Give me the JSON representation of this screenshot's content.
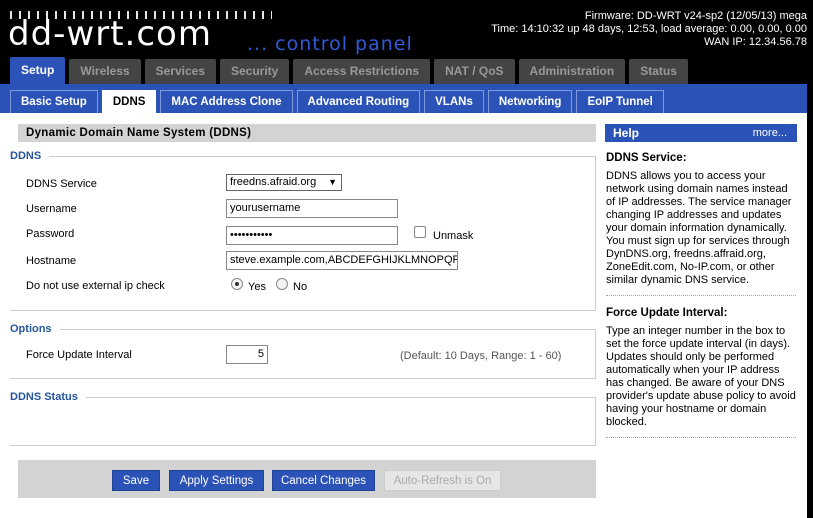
{
  "header": {
    "logo": "dd-wrt.com",
    "logo_sub": "... control panel",
    "firmware": "Firmware: DD-WRT v24-sp2 (12/05/13) mega",
    "time": "Time: 14:10:32 up 48 days, 12:53, load average: 0.00, 0.00, 0.00",
    "wan_ip": "WAN IP: 12.34.56.78"
  },
  "main_tabs": [
    "Setup",
    "Wireless",
    "Services",
    "Security",
    "Access Restrictions",
    "NAT / QoS",
    "Administration",
    "Status"
  ],
  "sub_tabs": [
    "Basic Setup",
    "DDNS",
    "MAC Address Clone",
    "Advanced Routing",
    "VLANs",
    "Networking",
    "EoIP Tunnel"
  ],
  "page_heading": "Dynamic Domain Name System (DDNS)",
  "ddns": {
    "legend": "DDNS",
    "service_label": "DDNS Service",
    "service_value": "freedns.afraid.org",
    "username_label": "Username",
    "username_value": "yourusername",
    "password_label": "Password",
    "password_value": "•••••••••••",
    "unmask_label": "Unmask",
    "hostname_label": "Hostname",
    "hostname_value": "steve.example.com,ABCDEFGHIJKLMNOPQRST",
    "extip_label": "Do not use external ip check",
    "yes_label": "Yes",
    "no_label": "No"
  },
  "options": {
    "legend": "Options",
    "interval_label": "Force Update Interval",
    "interval_value": "5",
    "interval_hint": "(Default: 10 Days, Range: 1 - 60)"
  },
  "status": {
    "legend": "DDNS Status"
  },
  "buttons": {
    "save": "Save",
    "apply": "Apply Settings",
    "cancel": "Cancel Changes",
    "autorefresh": "Auto-Refresh is On"
  },
  "help": {
    "title": "Help",
    "more": "more...",
    "service_title": "DDNS Service:",
    "service_text": "DDNS allows you to access your network using domain names instead of IP addresses. The service manager changing IP addresses and updates your domain information dynamically. You must sign up for services through DynDNS.org, freedns.affraid.org, ZoneEdit.com, No-IP.com, or other similar dynamic DNS service.",
    "interval_title": "Force Update Interval:",
    "interval_text": "Type an integer number in the box to set the force update interval (in days). Updates should only be performed automatically when your IP address has changed. Be aware of your DNS provider's update abuse policy to avoid having your hostname or domain blocked."
  },
  "colors": {
    "accent": "#2a52b7",
    "legend": "#25559a",
    "heading_bg": "#d3d3d3"
  }
}
